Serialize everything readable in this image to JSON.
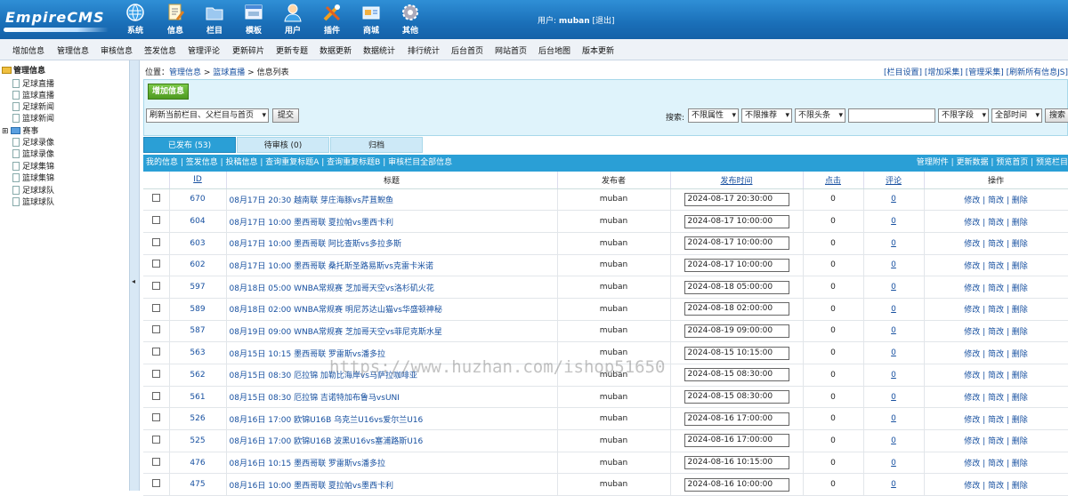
{
  "header": {
    "logo_text": "EmpireCMS",
    "nav": [
      {
        "label": "系统",
        "icon": "globe-icon"
      },
      {
        "label": "信息",
        "icon": "document-edit-icon"
      },
      {
        "label": "栏目",
        "icon": "folder-icon"
      },
      {
        "label": "模板",
        "icon": "template-window-icon"
      },
      {
        "label": "用户",
        "icon": "user-icon"
      },
      {
        "label": "插件",
        "icon": "tools-icon"
      },
      {
        "label": "商城",
        "icon": "shop-icon"
      },
      {
        "label": "其他",
        "icon": "gear-icon"
      }
    ],
    "user_label": "用户:",
    "username": "muban",
    "logout": "[退出]"
  },
  "menu": [
    "增加信息",
    "管理信息",
    "审核信息",
    "签发信息",
    "管理评论",
    "更新碎片",
    "更新专题",
    "数据更新",
    "数据统计",
    "排行统计",
    "后台首页",
    "网站首页",
    "后台地图",
    "版本更新"
  ],
  "sidebar": {
    "root": "管理信息",
    "items": [
      "足球直播",
      "篮球直播",
      "足球新闻",
      "篮球新闻"
    ],
    "group": "赛事",
    "items2": [
      "足球录像",
      "篮球录像",
      "足球集锦",
      "篮球集锦",
      "足球球队",
      "篮球球队"
    ],
    "collapse_glyph": "◂"
  },
  "breadcrumb": {
    "prefix": "位置：",
    "p1": "管理信息",
    "sep": " > ",
    "p2": "篮球直播",
    "p3": "信息列表"
  },
  "toplinks": "[栏目设置] [增加采集] [管理采集] [刷新所有信息JS]",
  "toolbar": {
    "add_label": "增加信息",
    "refresh_select": "刷新当前栏目、父栏目与首页",
    "submit_label": "提交",
    "search_label": "搜索:",
    "filter_attr": "不限属性",
    "filter_rec": "不限推荐",
    "filter_head": "不限头条",
    "search_value": "",
    "field_select": "不限字段",
    "time_select": "全部时间",
    "search_button": "搜索"
  },
  "tabs": [
    {
      "label": "已发布 (53)",
      "active": true
    },
    {
      "label": "待审核 (0)",
      "active": false
    },
    {
      "label": "归档",
      "active": false
    }
  ],
  "subbar": {
    "left": "我的信息 | 签发信息 | 投稿信息 | 查询重复标题A | 查询重复标题B | 审核栏目全部信息",
    "right": "管理附件 | 更新数据 | 预览首页 | 预览栏目"
  },
  "table": {
    "columns": [
      "",
      "ID",
      "标题",
      "发布者",
      "发布时间",
      "点击",
      "评论",
      "操作"
    ],
    "ops": "修改 | 简改 | 删除",
    "rows": [
      {
        "id": "670",
        "title": "08月17日 20:30 越南联 芽庄海豚vs芹苴鲵鱼",
        "author": "muban",
        "time": "2024-08-17 20:30:00",
        "clicks": "0",
        "comments": "0"
      },
      {
        "id": "604",
        "title": "08月17日 10:00 墨西哥联 夏拉帕vs墨西卡利",
        "author": "muban",
        "time": "2024-08-17 10:00:00",
        "clicks": "0",
        "comments": "0"
      },
      {
        "id": "603",
        "title": "08月17日 10:00 墨西哥联 阿比查斯vs多拉多斯",
        "author": "muban",
        "time": "2024-08-17 10:00:00",
        "clicks": "0",
        "comments": "0"
      },
      {
        "id": "602",
        "title": "08月17日 10:00 墨西哥联 桑托斯圣路易斯vs克雷卡米诺",
        "author": "muban",
        "time": "2024-08-17 10:00:00",
        "clicks": "0",
        "comments": "0"
      },
      {
        "id": "597",
        "title": "08月18日 05:00 WNBA常规赛 芝加哥天空vs洛杉矶火花",
        "author": "muban",
        "time": "2024-08-18 05:00:00",
        "clicks": "0",
        "comments": "0"
      },
      {
        "id": "589",
        "title": "08月18日 02:00 WNBA常规赛 明尼苏达山猫vs华盛顿神秘",
        "author": "muban",
        "time": "2024-08-18 02:00:00",
        "clicks": "0",
        "comments": "0"
      },
      {
        "id": "587",
        "title": "08月19日 09:00 WNBA常规赛 芝加哥天空vs菲尼克斯水星",
        "author": "muban",
        "time": "2024-08-19 09:00:00",
        "clicks": "0",
        "comments": "0"
      },
      {
        "id": "563",
        "title": "08月15日 10:15 墨西哥联 罗雷斯vs潘多拉",
        "author": "muban",
        "time": "2024-08-15 10:15:00",
        "clicks": "0",
        "comments": "0"
      },
      {
        "id": "562",
        "title": "08月15日 08:30 厄拉锦 加勒比海岸vs马萨拉咖啡亚",
        "author": "muban",
        "time": "2024-08-15 08:30:00",
        "clicks": "0",
        "comments": "0"
      },
      {
        "id": "561",
        "title": "08月15日 08:30 厄拉锦 吉诺特加布鲁马vsUNI",
        "author": "muban",
        "time": "2024-08-15 08:30:00",
        "clicks": "0",
        "comments": "0"
      },
      {
        "id": "526",
        "title": "08月16日 17:00 欧锦U16B 乌克兰U16vs爱尔兰U16",
        "author": "muban",
        "time": "2024-08-16 17:00:00",
        "clicks": "0",
        "comments": "0"
      },
      {
        "id": "525",
        "title": "08月16日 17:00 欧锦U16B 波黑U16vs塞浦路斯U16",
        "author": "muban",
        "time": "2024-08-16 17:00:00",
        "clicks": "0",
        "comments": "0"
      },
      {
        "id": "476",
        "title": "08月16日 10:15 墨西哥联 罗雷斯vs潘多拉",
        "author": "muban",
        "time": "2024-08-16 10:15:00",
        "clicks": "0",
        "comments": "0"
      },
      {
        "id": "475",
        "title": "08月16日 10:00 墨西哥联 夏拉帕vs墨西卡利",
        "author": "muban",
        "time": "2024-08-16 10:00:00",
        "clicks": "0",
        "comments": "0"
      }
    ]
  },
  "watermark": "https://www.huzhan.com/ishop51650",
  "colors": {
    "header": "#1a6fb8",
    "tab_active": "#2a9fd6",
    "panel": "#dff3fb",
    "link": "#1750a0"
  }
}
